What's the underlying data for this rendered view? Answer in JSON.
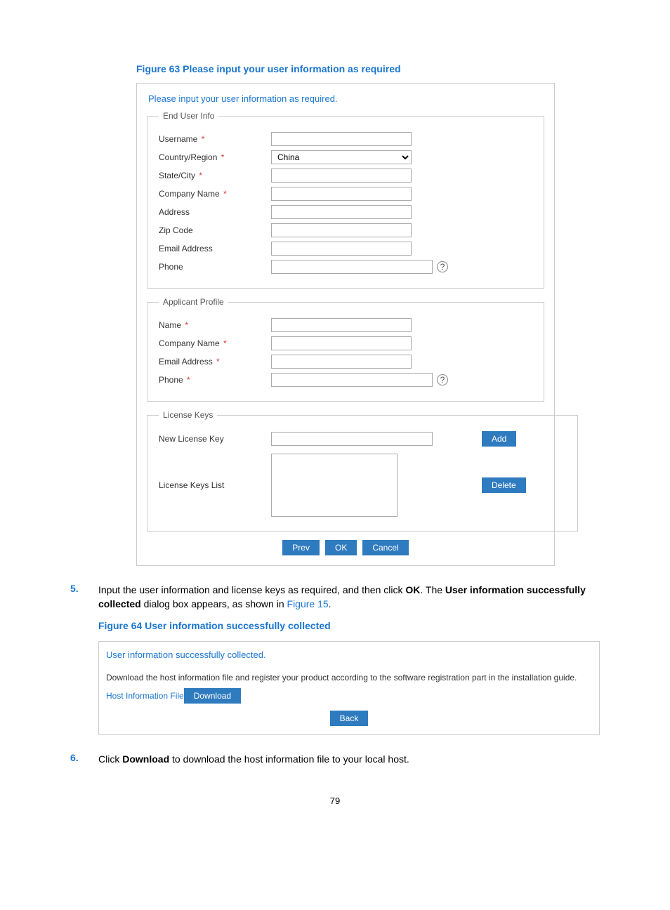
{
  "figure63": {
    "caption": "Figure 63 Please input your user information as required",
    "dialog_title": "Please input your user information as required.",
    "sections": {
      "end_user": {
        "legend": "End User Info",
        "username_label": "Username",
        "country_label": "Country/Region",
        "country_value": "China",
        "state_label": "State/City",
        "company_label": "Company Name",
        "address_label": "Address",
        "zip_label": "Zip Code",
        "email_label": "Email Address",
        "phone_label": "Phone"
      },
      "applicant": {
        "legend": "Applicant Profile",
        "name_label": "Name",
        "company_label": "Company Name",
        "email_label": "Email Address",
        "phone_label": "Phone"
      },
      "license": {
        "legend": "License Keys",
        "new_key_label": "New License Key",
        "list_label": "License Keys List",
        "add_btn": "Add",
        "delete_btn": "Delete"
      }
    },
    "buttons": {
      "prev": "Prev",
      "ok": "OK",
      "cancel": "Cancel"
    },
    "required_mark": "*",
    "help_glyph": "?"
  },
  "step5": {
    "num": "5.",
    "text_a": "Input the user information and license keys as required, and then click ",
    "ok": "OK",
    "text_b": ". The ",
    "bold": "User information successfully collected",
    "text_c": " dialog box appears, as shown in ",
    "xref": "Figure 15",
    "dot": "."
  },
  "figure64": {
    "caption": "Figure 64 User information successfully collected",
    "dialog_title": "User information successfully collected.",
    "instruction": "Download the host information file and register your product according to the software registration part in the installation guide.",
    "hif_label": "Host Information File",
    "download_btn": "Download",
    "back_btn": "Back"
  },
  "step6": {
    "num": "6.",
    "text_a": "Click ",
    "bold": "Download",
    "text_b": " to download the host information file to your local host."
  },
  "page_number": "79"
}
